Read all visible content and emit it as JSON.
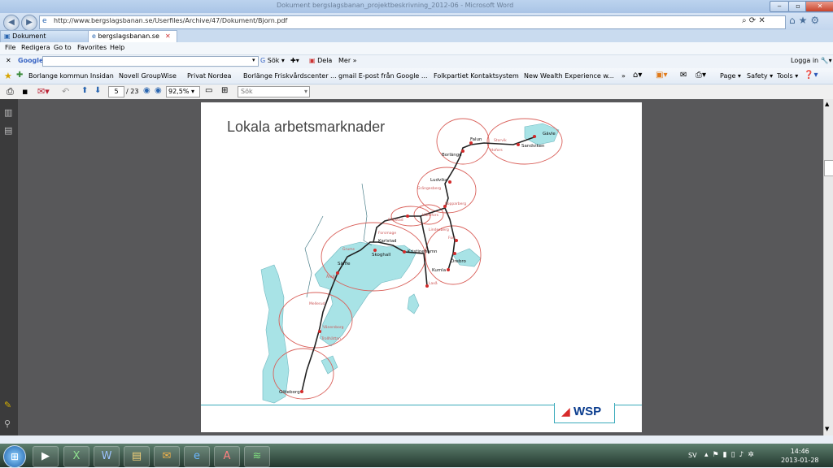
{
  "window": {
    "title": "Dokument bergslagsbanan_projektbeskrivning_2012-06 - Microsoft Word"
  },
  "address": {
    "url": "http://www.bergslagsbanan.se/Userfiles/Archive/47/Dokument/Bjorn.pdf"
  },
  "tabs": [
    {
      "label": "Dokument"
    },
    {
      "label": "bergslagsbanan.se"
    }
  ],
  "menu": [
    "File",
    "Redigera",
    "Go to",
    "Favorites",
    "Help"
  ],
  "google": {
    "label": "Google",
    "search": "Sök",
    "share": "Dela",
    "more": "Mer",
    "login": "Logga in"
  },
  "favorites": [
    "Borlange kommun Insidan",
    "Novell GroupWise",
    "Privat  Nordea",
    "Borlänge Friskvårdscenter ...",
    "gmail E-post från Google ...",
    "Folkpartiet Kontaktsystem",
    "New Wealth Experience w..."
  ],
  "commandbar": {
    "page": "Page",
    "safety": "Safety",
    "tools": "Tools"
  },
  "pdf": {
    "page": "5",
    "total": "/ 23",
    "zoom": "92,5%",
    "search_placeholder": "Sök"
  },
  "slide": {
    "title": "Lokala arbetsmarknader",
    "logo": "WSP",
    "places": {
      "falun": "Falun",
      "borlange": "Borlänge",
      "storvik": "Storvik",
      "hofors": "Hofors",
      "sandviken": "Sandviken",
      "gavle": "Gävle",
      "ludvika": "Ludvika",
      "grangesberg": "Grängesberg",
      "kopparberg": "Kopparberg",
      "hallefors": "Hällefors",
      "filipstad": "Filipstad",
      "lindesberg": "Lindesberg",
      "fors": "Fors",
      "forsmage": "Forsmage",
      "karlstad": "Karlstad",
      "skoghall": "Skoghall",
      "kristinehamn": "Kristinehamn",
      "saffle": "Säffle",
      "grums": "Grums",
      "amal": "Åmål",
      "orebro": "Örebro",
      "kumla": "Kumla",
      "laxa": "Laxå",
      "mellerud": "Mellerud",
      "vanersborg": "Vänersborg",
      "trollhattan": "Trollhättan",
      "goteborg": "Göteborg"
    }
  },
  "taskbar": {
    "lang": "SV",
    "time": "14:46",
    "date": "2013-01-28"
  }
}
